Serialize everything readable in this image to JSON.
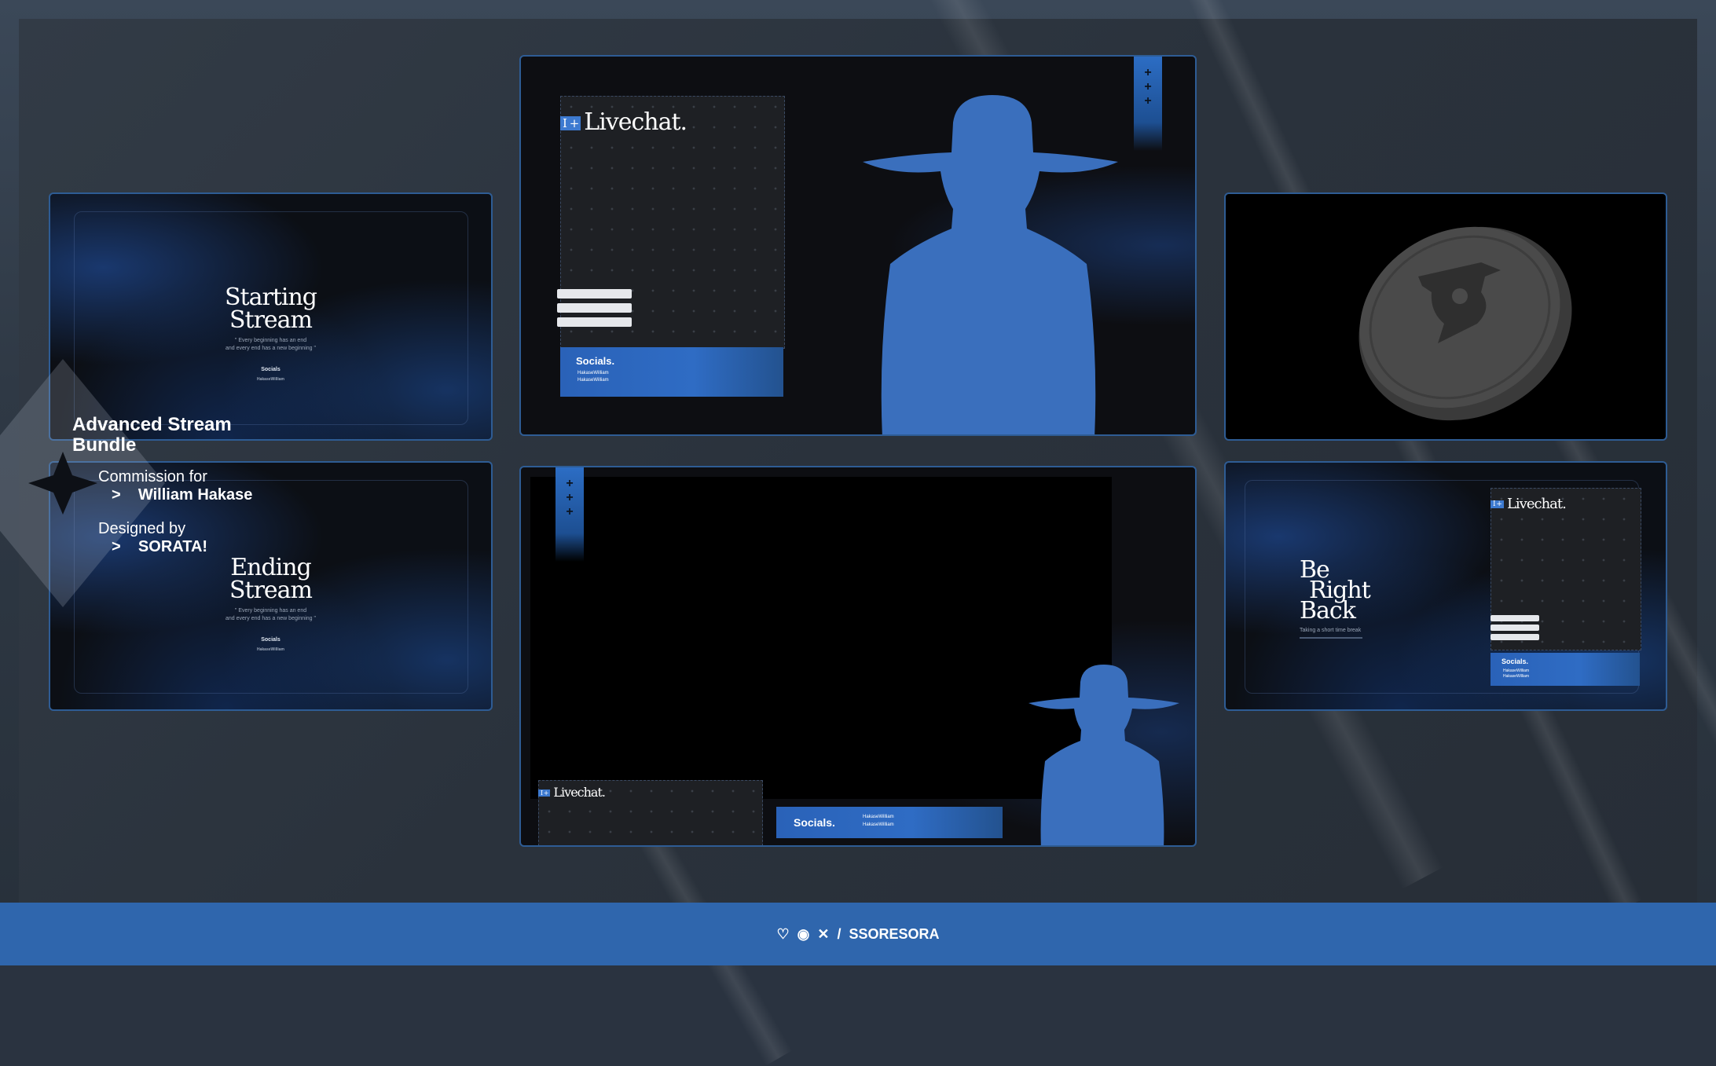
{
  "bundle": {
    "title_line1": "Advanced Stream",
    "title_line2": "Bundle",
    "commission_label": "Commission for",
    "client_arrow": ">",
    "client_name": "William Hakase",
    "designed_label": "Designed by",
    "designer_arrow": ">",
    "designer_name": "SORATA!"
  },
  "starting": {
    "title_line1": "Starting",
    "title_line2": "Stream",
    "quote_line1": "\" Every beginning has an end",
    "quote_line2": "and every end has a new beginning \"",
    "socials_label": "Socials",
    "handle": "HakaseWilliam"
  },
  "ending": {
    "title_line1": "Ending",
    "title_line2": "Stream",
    "quote_line1": "\" Every beginning has an end",
    "quote_line2": "and every end has a new beginning \"",
    "socials_label": "Socials",
    "handle": "HakaseWilliam"
  },
  "main_overlay": {
    "livechat_title": "Livechat.",
    "socials_label": "Socials.",
    "handle_1": "HakaseWilliam",
    "handle_2": "HakaseWilliam",
    "ribbon_marks": [
      "+",
      "+",
      "+"
    ]
  },
  "game_overlay": {
    "livechat_title": "Livechat.",
    "socials_label": "Socials.",
    "handle_1": "HakaseWilliam",
    "handle_2": "HakaseWilliam",
    "ribbon_marks": [
      "+",
      "+",
      "+"
    ]
  },
  "brb": {
    "title_line1": "Be",
    "title_line2": "Right",
    "title_line3": "Back",
    "subtitle": "Taking a short time break",
    "livechat_title": "Livechat.",
    "socials_label": "Socials.",
    "handle_1": "HakaseWilliam",
    "handle_2": "HakaseWilliam"
  },
  "footer": {
    "separator": "/",
    "handle": "SSORESORA",
    "icons": [
      "heart-link-icon",
      "discord-icon",
      "x-icon"
    ]
  },
  "colors": {
    "accent_blue": "#3a6fbd",
    "footer_blue": "#2f66ad",
    "panel_border": "#2e5c94"
  }
}
